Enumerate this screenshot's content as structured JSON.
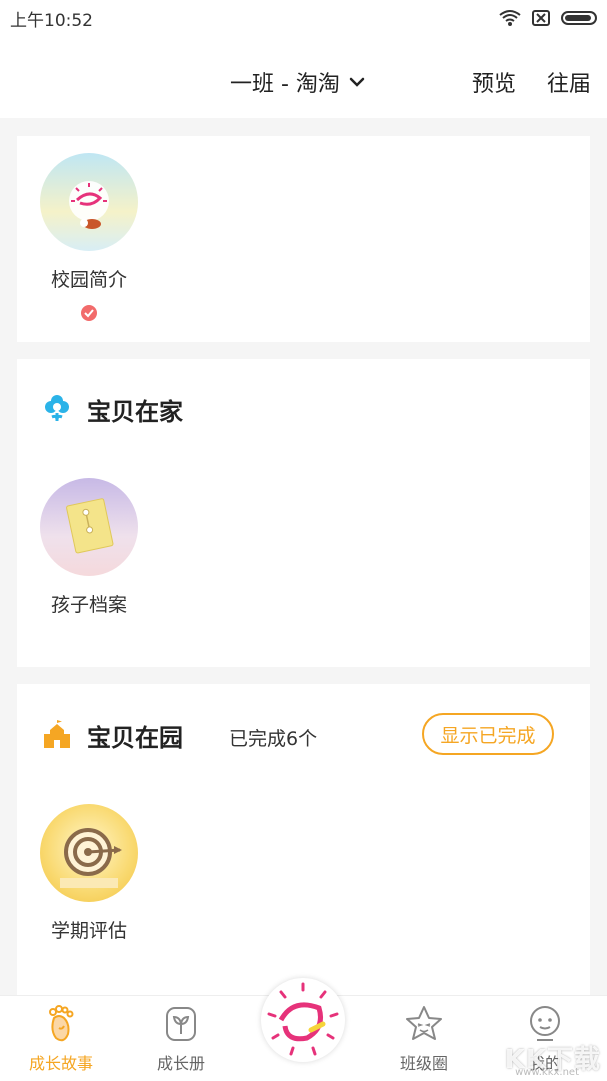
{
  "status_bar": {
    "time": "上午10:52"
  },
  "header": {
    "class_selector": "一班 - 淘淘",
    "preview": "预览",
    "past_years": "往届"
  },
  "campus_card": {
    "item": {
      "label": "校园简介",
      "icon": "campus-logo"
    }
  },
  "home_section": {
    "title": "宝贝在家",
    "icon": "flower-icon",
    "item": {
      "label": "孩子档案",
      "icon": "archive-icon"
    }
  },
  "school_section": {
    "title": "宝贝在园",
    "icon": "castle-icon",
    "done_count": "已完成6个",
    "show_done_button": "显示已完成",
    "item": {
      "label": "学期评估",
      "icon": "target-icon"
    }
  },
  "tab_bar": {
    "tabs": [
      {
        "label": "成长故事",
        "icon": "footprint-icon",
        "active": true
      },
      {
        "label": "成长册",
        "icon": "sprout-icon",
        "active": false
      },
      {
        "label": "班级圈",
        "icon": "star-face-icon",
        "active": false
      },
      {
        "label": "我的",
        "icon": "person-icon",
        "active": false
      }
    ]
  },
  "watermark": {
    "text": "KK下载",
    "sub": "www.kkx.net"
  },
  "colors": {
    "accent": "#f5a623",
    "section_icon_blue": "#2bb3e8",
    "check_red": "#f26b6b",
    "logo_pink": "#e6327a"
  }
}
